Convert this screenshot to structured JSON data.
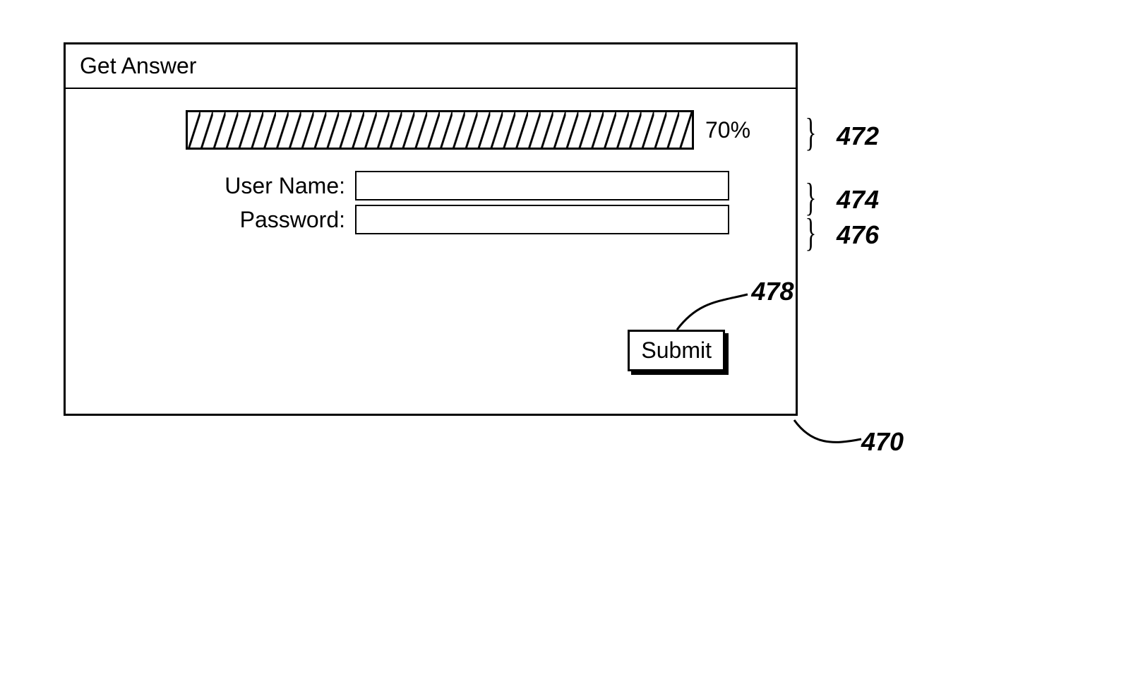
{
  "window": {
    "title": "Get Answer"
  },
  "progress": {
    "percent": 70,
    "label": "70%"
  },
  "form": {
    "username_label": "User Name:",
    "username_value": "",
    "password_label": "Password:",
    "password_value": ""
  },
  "actions": {
    "submit_label": "Submit"
  },
  "callouts": {
    "window_ref": "470",
    "progress_ref": "472",
    "username_ref": "474",
    "password_ref": "476",
    "submit_ref": "478"
  }
}
